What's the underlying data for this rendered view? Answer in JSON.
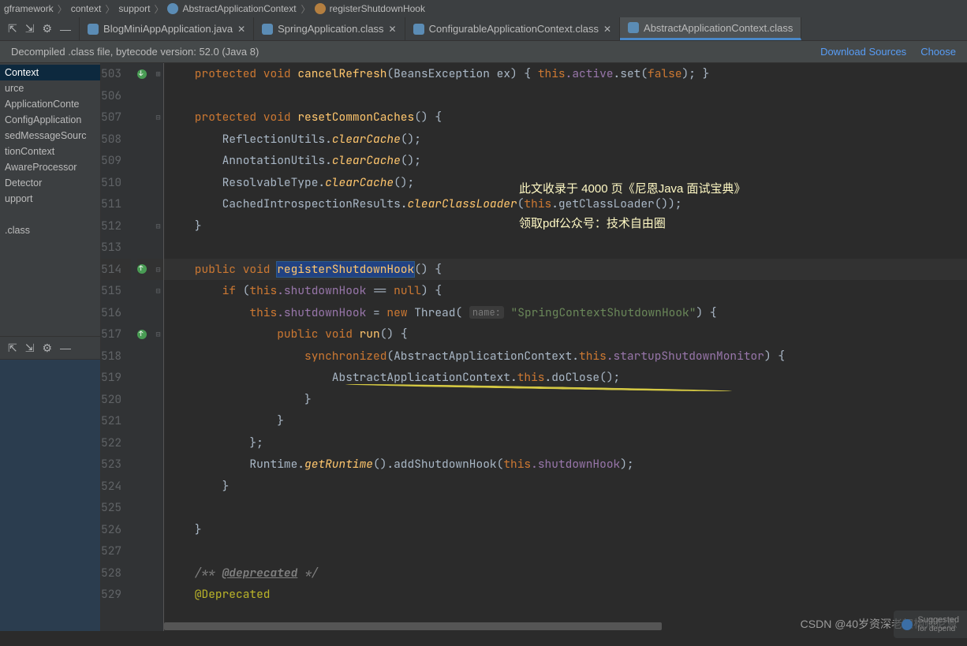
{
  "breadcrumb": {
    "items": [
      "gframework",
      "context",
      "support",
      "AbstractApplicationContext",
      "registerShutdownHook"
    ]
  },
  "tabs": {
    "items": [
      {
        "label": "BlogMiniAppApplication.java",
        "icon": "java",
        "active": false
      },
      {
        "label": "SpringApplication.class",
        "icon": "class",
        "active": false
      },
      {
        "label": "ConfigurableApplicationContext.class",
        "icon": "class",
        "active": false
      },
      {
        "label": "AbstractApplicationContext.class",
        "icon": "class",
        "active": true
      }
    ]
  },
  "notice": {
    "message": "Decompiled .class file, bytecode version: 52.0 (Java 8)",
    "download": "Download Sources",
    "choose": "Choose"
  },
  "sidebar": {
    "items": [
      {
        "label": "Context",
        "sel": true
      },
      {
        "label": "urce"
      },
      {
        "label": "ApplicationConte"
      },
      {
        "label": "ConfigApplication"
      },
      {
        "label": "sedMessageSourc"
      },
      {
        "label": "tionContext"
      },
      {
        "label": "AwareProcessor"
      },
      {
        "label": "Detector"
      },
      {
        "label": "upport"
      },
      {
        "label": ""
      },
      {
        "label": ".class"
      }
    ]
  },
  "lines": {
    "start": 503,
    "nums": [
      503,
      506,
      507,
      508,
      509,
      510,
      511,
      512,
      513,
      514,
      515,
      516,
      517,
      518,
      519,
      520,
      521,
      522,
      523,
      524,
      525,
      526,
      527,
      528,
      529
    ]
  },
  "code": {
    "l503_prefix": "    protected void ",
    "l503_fn": "cancelRefresh",
    "l503_mid": "(BeansException ex) { ",
    "l503_this": "this",
    "l503_field": ".active",
    "l503_set": ".set(",
    "l503_false": "false",
    "l503_end": "); }",
    "l507_prefix": "    protected void ",
    "l507_fn": "resetCommonCaches",
    "l507_end": "() {",
    "l508": "        ReflectionUtils.",
    "l508_fn": "clearCache",
    "l508_end": "();",
    "l509": "        AnnotationUtils.",
    "l509_fn": "clearCache",
    "l509_end": "();",
    "l510": "        ResolvableType.",
    "l510_fn": "clearCache",
    "l510_end": "();",
    "l511": "        CachedIntrospectionResults.",
    "l511_fn": "clearClassLoader",
    "l511_mid": "(",
    "l511_this": "this",
    "l511_end": ".getClassLoader());",
    "l512": "    }",
    "l514_pub": "    public void ",
    "l514_fn": "registerShutdownHook",
    "l514_end": "() {",
    "l515_if": "        if ",
    "l515_open": "(",
    "l515_this": "this",
    "l515_field": ".shutdownHook",
    "l515_eq": " == ",
    "l515_null": "null",
    "l515_end": ") {",
    "l516_this": "            this",
    "l516_field": ".shutdownHook",
    "l516_eq": " = ",
    "l516_new": "new ",
    "l516_thread": "Thread( ",
    "l516_hint": "name:",
    "l516_str": " \"SpringContextShutdownHook\"",
    "l516_end": ") {",
    "l517_pub": "                public void ",
    "l517_fn": "run",
    "l517_end": "() {",
    "l518_sync": "                    synchronized",
    "l518_open": "(AbstractApplicationContext.",
    "l518_this": "this",
    "l518_field": ".startupShutdownMonitor",
    "l518_end": ") {",
    "l519": "                        AbstractApplicationContext.",
    "l519_this": "this",
    "l519_fn": ".doClose",
    "l519_end": "();",
    "l520": "                    }",
    "l521": "                }",
    "l522": "            };",
    "l523": "            Runtime.",
    "l523_fn": "getRuntime",
    "l523_mid": "().addShutdownHook(",
    "l523_this": "this",
    "l523_field": ".shutdownHook",
    "l523_end": ");",
    "l524": "        }",
    "l526": "    }",
    "l528_cmt1": "    /** ",
    "l528_dep": "@deprecated",
    "l528_cmt2": " */",
    "l529": "    @Deprecated"
  },
  "annotations": {
    "wm1": "此文收录于 4000 页《尼恩Java 面试宝典》",
    "wm2": "领取pdf公众号：技术自由圈",
    "bottom": "CSDN @40岁资深老架构师尼恩",
    "suggested": "Suggested",
    "suggested2": "for depend"
  }
}
